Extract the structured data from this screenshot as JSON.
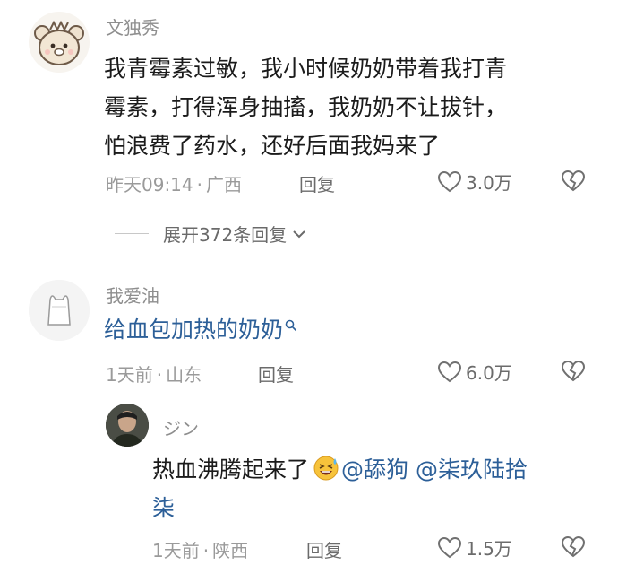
{
  "comments": [
    {
      "username": "文独秀",
      "lines": [
        "我青霉素过敏，我小时候奶奶带着我打青",
        "霉素，打得浑身抽搐，我奶奶不让拔针，",
        "怕浪费了药水，还好后面我妈来了"
      ],
      "time": "昨天09:14",
      "location": "广西",
      "reply_label": "回复",
      "likes": "3.0万",
      "expand_label": "展开372条回复"
    },
    {
      "username": "我爱油",
      "text": "给血包加热的奶奶",
      "time": "1天前",
      "location": "山东",
      "reply_label": "回复",
      "likes": "6.0万"
    },
    {
      "username": "ジン",
      "text_line1_prefix": "热血沸腾起来了",
      "mention1": "@舔狗",
      "mention2_part1": "@柒玖陆拾",
      "mention2_part2": "柒",
      "time": "1天前",
      "location": "陕西",
      "reply_label": "回复",
      "likes": "1.5万"
    }
  ],
  "separator": "·",
  "colors": {
    "mention": "#2c5f98",
    "meta": "#9a9a9a",
    "body": "#1b1b1b"
  },
  "icons": {
    "like": "heart-outline-icon",
    "dislike": "broken-heart-icon",
    "search": "search-icon",
    "expand": "chevron-down-icon"
  }
}
